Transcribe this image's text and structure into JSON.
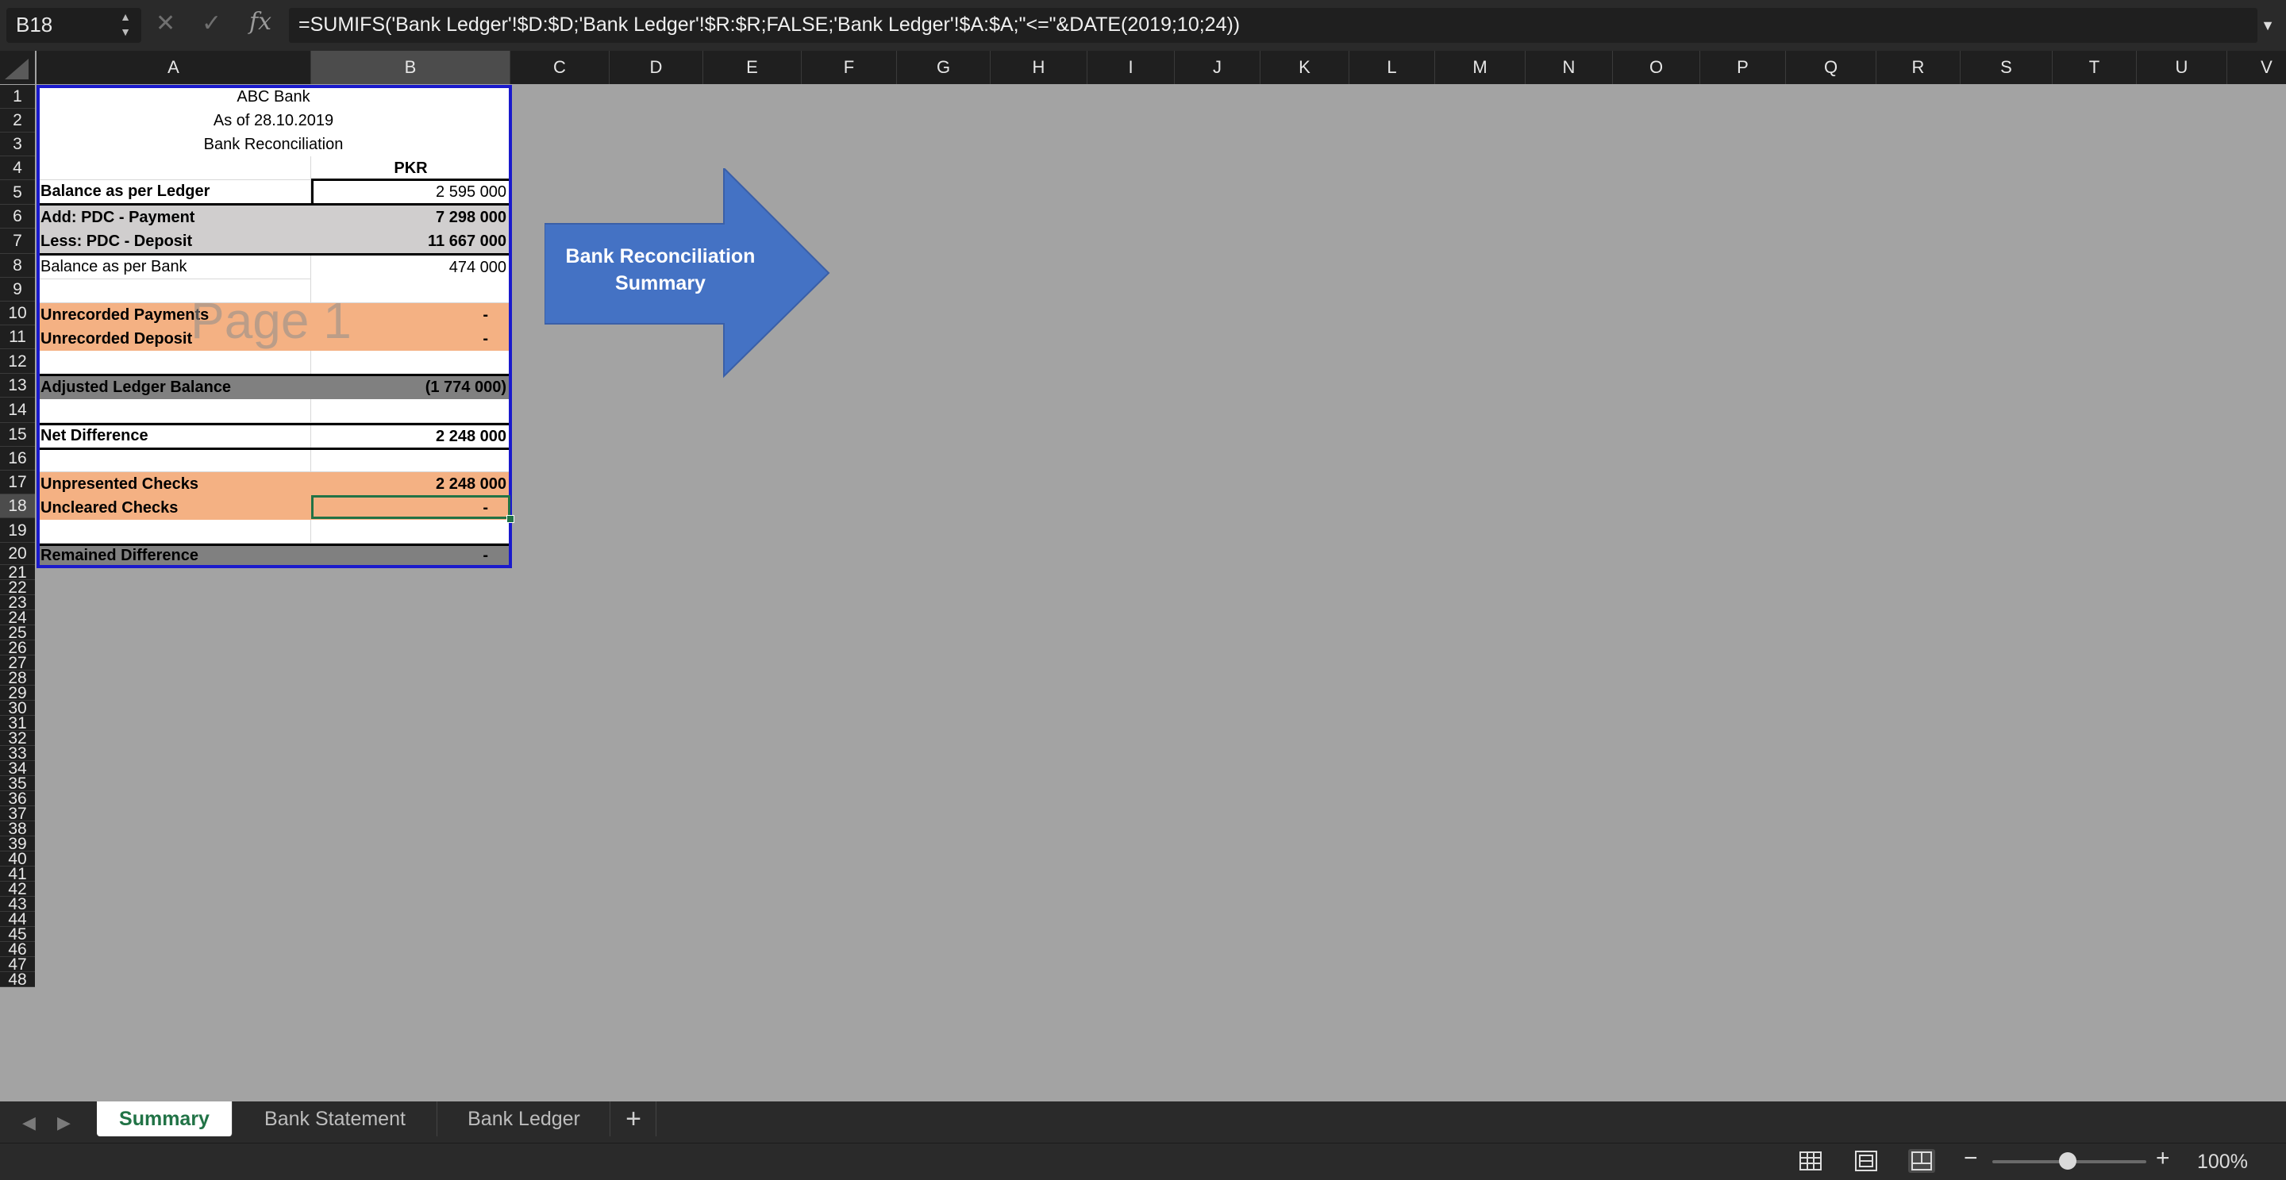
{
  "formula_bar": {
    "cell_ref": "B18",
    "formula": "=SUMIFS('Bank Ledger'!$D:$D;'Bank Ledger'!$R:$R;FALSE;'Bank Ledger'!$A:$A;\"<=\"&DATE(2019;10;24))",
    "fx_label": "fx",
    "cancel_icon": "close-icon",
    "enter_icon": "check-icon"
  },
  "columns": [
    "A",
    "B",
    "C",
    "D",
    "E",
    "F",
    "G",
    "H",
    "I",
    "J",
    "K",
    "L",
    "M",
    "N",
    "O",
    "P",
    "Q",
    "R",
    "S",
    "T",
    "U",
    "V"
  ],
  "selected_column": "B",
  "selected_row": "18",
  "rows": [
    "1",
    "2",
    "3",
    "4",
    "5",
    "6",
    "7",
    "8",
    "9",
    "10",
    "11",
    "12",
    "13",
    "14",
    "15",
    "16",
    "17",
    "18",
    "19",
    "20",
    "21",
    "22",
    "23",
    "24",
    "25",
    "26",
    "27",
    "28",
    "29",
    "30",
    "31",
    "32",
    "33",
    "34",
    "35",
    "36",
    "37",
    "38",
    "39",
    "40",
    "41",
    "42",
    "43",
    "44",
    "45",
    "46",
    "47",
    "48"
  ],
  "sheet": {
    "title1": "ABC Bank",
    "title2": "As of 28.10.2019",
    "title3": "Bank Reconciliation",
    "currency": "PKR",
    "balance_ledger": {
      "label": "Balance as per Ledger",
      "value": "2 595 000"
    },
    "add_pdc": {
      "label": "Add: PDC - Payment",
      "value": "7 298 000"
    },
    "less_pdc": {
      "label": "Less: PDC - Deposit",
      "value": "11 667 000"
    },
    "balance_bank": {
      "label": "Balance as per Bank",
      "value": "474 000"
    },
    "unrec_payments": {
      "label": "Unrecorded Payments",
      "value": "-"
    },
    "unrec_deposit": {
      "label": "Unrecorded Deposit",
      "value": "-"
    },
    "adjusted": {
      "label": "Adjusted Ledger Balance",
      "value": "(1 774 000)"
    },
    "net_diff": {
      "label": "Net Difference",
      "value": "2 248 000"
    },
    "unpresented": {
      "label": "Unpresented Checks",
      "value": "2 248 000"
    },
    "uncleared": {
      "label": "Uncleared Checks",
      "value": "-"
    },
    "remained": {
      "label": "Remained Difference",
      "value": "-"
    }
  },
  "watermark": "Page 1",
  "shape": {
    "line1": "Bank Reconciliation",
    "line2": "Summary",
    "fill": "#4472c4"
  },
  "tabs": [
    "Summary",
    "Bank Statement",
    "Bank Ledger"
  ],
  "active_tab": "Summary",
  "add_tab_label": "+",
  "zoom": "100%",
  "colors": {
    "accent": "#217346",
    "salmon": "#f4b183",
    "grey": "#d0cece",
    "dark": "#808080",
    "table_border": "#1a1acc"
  }
}
